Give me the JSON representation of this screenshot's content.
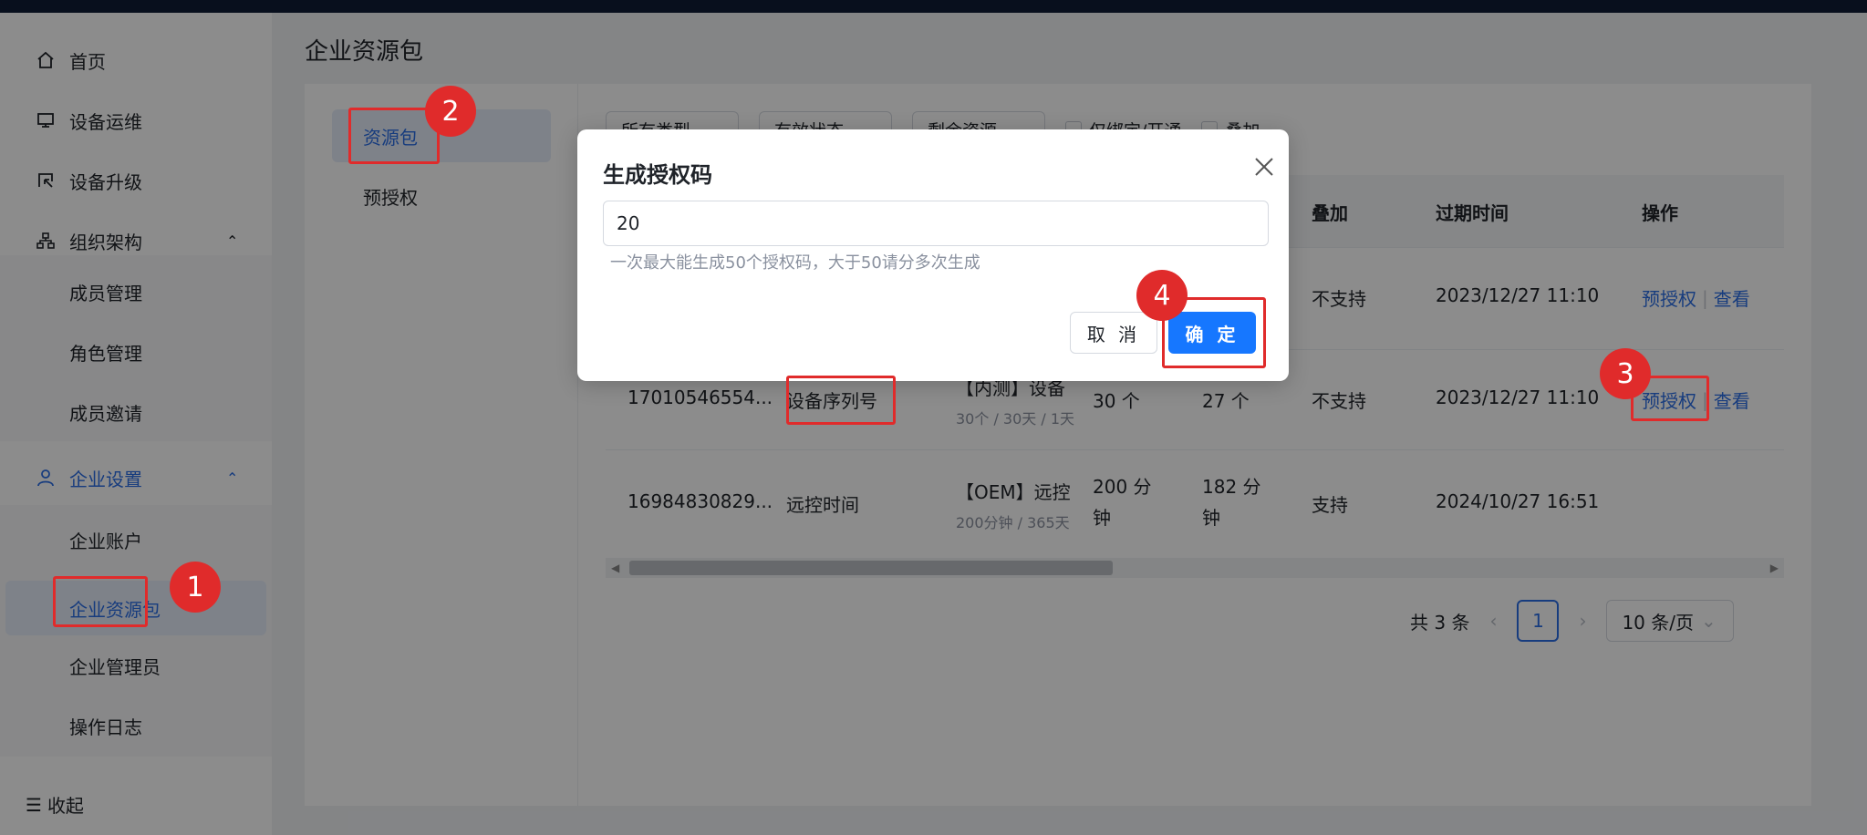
{
  "sidebar": {
    "items": [
      {
        "label": "首页"
      },
      {
        "label": "设备运维"
      },
      {
        "label": "设备升级"
      },
      {
        "label": "组织架构"
      }
    ],
    "org_sub": [
      "成员管理",
      "角色管理",
      "成员邀请"
    ],
    "enterprise": {
      "label": "企业设置"
    },
    "enterprise_sub": [
      "企业账户",
      "企业资源包",
      "企业管理员",
      "操作日志"
    ],
    "collapse_label": "收起"
  },
  "page": {
    "title": "企业资源包"
  },
  "subnav": [
    "资源包",
    "预授权"
  ],
  "filters": {
    "f1": "所有类型",
    "f2": "有效状态",
    "f3": "剩余资源",
    "chk1": "仅绑定/开通",
    "chk2": "叠加"
  },
  "table": {
    "headers": {
      "stack": "叠加",
      "expire": "过期时间",
      "ops": "操作"
    },
    "rows": [
      {
        "stack": "不支持",
        "expire": "2023/12/27 11:10",
        "op1": "预授权",
        "op2": "查看"
      },
      {
        "id": "17010546554...",
        "type": "设备序列号",
        "name": "【内测】设备",
        "sub": "30个 / 30天 / 1天",
        "total": "30 个",
        "remain": "27 个",
        "stack": "不支持",
        "expire": "2023/12/27 11:10",
        "op1": "预授权",
        "op2": "查看"
      },
      {
        "id": "16984830829...",
        "type": "远控时间",
        "name": "【OEM】远控",
        "sub": "200分钟 / 365天",
        "total1": "200 分",
        "total2": "钟",
        "remain1": "182 分",
        "remain2": "钟",
        "stack": "支持",
        "expire": "2024/10/27 16:51"
      }
    ]
  },
  "pager": {
    "total": "共 3 条",
    "current": "1",
    "size": "10 条/页"
  },
  "modal": {
    "title": "生成授权码",
    "input_value": "20",
    "hint": "一次最大能生成50个授权码，大于50请分多次生成",
    "cancel": "取 消",
    "ok": "确 定"
  },
  "markers": [
    "1",
    "2",
    "3",
    "4"
  ],
  "colors": {
    "accent": "#1677ff",
    "annotation": "#e02b2b"
  }
}
